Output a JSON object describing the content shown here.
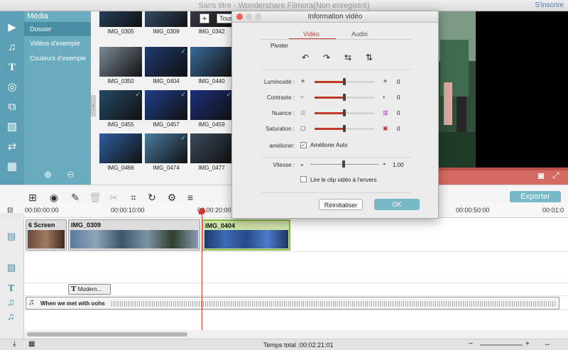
{
  "window": {
    "title": "Sans titre - Wondershare Filmora(Non enregistré)",
    "signin": "S'inscrire"
  },
  "media": {
    "header": "Média",
    "items": [
      "Dossier",
      "Vidéos d'exemple",
      "Couleurs d'exemple"
    ]
  },
  "toolbar_top": {
    "plus": "+",
    "tous": "Tous"
  },
  "thumbnails": [
    {
      "label": "IMG_0305",
      "checked": false
    },
    {
      "label": "IMG_0309",
      "checked": false
    },
    {
      "label": "IMG_0342",
      "checked": false
    },
    {
      "label": "IMG_0350",
      "checked": false
    },
    {
      "label": "IMG_0404",
      "checked": true
    },
    {
      "label": "IMG_0440",
      "checked": false
    },
    {
      "label": "IMG_0455",
      "checked": true
    },
    {
      "label": "IMG_0457",
      "checked": true
    },
    {
      "label": "IMG_0459",
      "checked": true
    },
    {
      "label": "IMG_0466",
      "checked": false
    },
    {
      "label": "IMG_0474",
      "checked": true
    },
    {
      "label": "IMG_0477",
      "checked": false
    }
  ],
  "export_label": "Exporter",
  "ruler": [
    "00:00:00:00",
    "00:00:10:00",
    "00:00:20:00",
    "00:00:50:00",
    "00:01:0"
  ],
  "clips": {
    "clip1": "6 Screen",
    "clip2": "IMG_0309",
    "clip3": "IMG_0404",
    "text_clip": "Modern...",
    "audio": "When we met with oohs"
  },
  "status": {
    "total_time": "Temps total :00:02:21:01"
  },
  "dialog": {
    "title": "Information vidéo",
    "tabs": [
      "Vidéo",
      "Audio"
    ],
    "rotate_label": "Pivoter",
    "sliders": [
      {
        "label": "Luminosité :",
        "value": "0",
        "level": 0.5
      },
      {
        "label": "Contraste :",
        "value": "0",
        "level": 0.5
      },
      {
        "label": "Nuance :",
        "value": "0",
        "level": 0.5
      },
      {
        "label": "Saturation :",
        "value": "0",
        "level": 0.5
      }
    ],
    "improve_label": "améliorer:",
    "auto_label": "Améliorer Auto",
    "speed_label": "Vitesse :",
    "speed_value": "1.00",
    "reverse_label": "Lire le clip vidéo à l'envers",
    "reset_label": "Réinitialiser",
    "ok_label": "OK"
  },
  "colors": {
    "accent": "#6aacbf",
    "active": "#c0392b",
    "ok": "#78b9c8"
  }
}
